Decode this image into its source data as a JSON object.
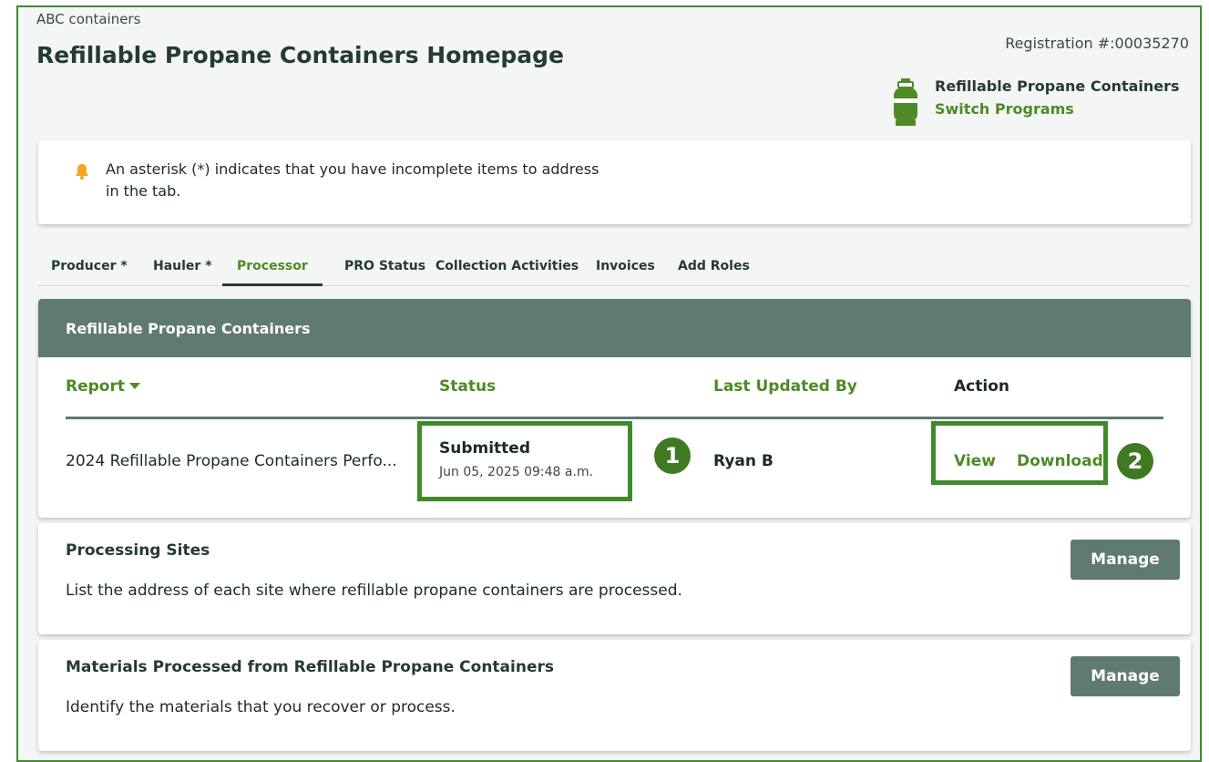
{
  "header": {
    "company": "ABC containers",
    "title": "Refillable Propane Containers Homepage",
    "registration": "Registration #:00035270",
    "program_icon": "propane-tank-icon",
    "program_name": "Refillable Propane Containers",
    "switch_programs": "Switch Programs"
  },
  "alert": {
    "icon": "bell-icon",
    "message": "An asterisk (*) indicates that you have incomplete items to address in the tab."
  },
  "tabs": [
    {
      "label": "Producer *"
    },
    {
      "label": "Hauler *"
    },
    {
      "label": "Processor",
      "active": true
    },
    {
      "label": "PRO Status"
    },
    {
      "label": "Collection Activities"
    },
    {
      "label": "Invoices"
    },
    {
      "label": "Add Roles"
    }
  ],
  "reports_card": {
    "title": "Refillable Propane Containers",
    "columns": {
      "report": "Report",
      "status": "Status",
      "last_updated_by": "Last Updated By",
      "action": "Action"
    },
    "rows": [
      {
        "report": "2024 Refillable Propane Containers Perfo...",
        "status": "Submitted",
        "status_date": "Jun 05, 2025 09:48 a.m.",
        "last_updated_by": "Ryan B",
        "view_label": "View",
        "download_label": "Download"
      }
    ]
  },
  "callouts": [
    "1",
    "2"
  ],
  "sections": [
    {
      "title": "Processing Sites",
      "description": "List the address of each site where refillable propane containers are processed.",
      "button": "Manage"
    },
    {
      "title": "Materials Processed from Refillable Propane Containers",
      "description": "Identify the materials that you recover or process.",
      "button": "Manage"
    }
  ],
  "colors": {
    "brand_green": "#4e8a25",
    "header_bar": "#5f7a70",
    "highlight_border": "#3f8a2a",
    "alert_icon": "#f5a623"
  }
}
